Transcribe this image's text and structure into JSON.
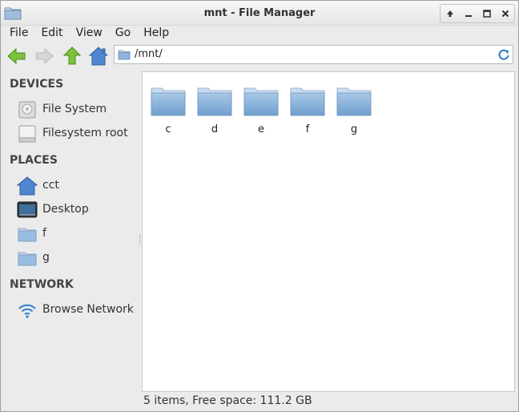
{
  "window": {
    "title": "mnt - File Manager"
  },
  "menu": [
    "File",
    "Edit",
    "View",
    "Go",
    "Help"
  ],
  "location": {
    "path": "/mnt/"
  },
  "sidebar": {
    "devices_title": "DEVICES",
    "devices": [
      {
        "label": "File System",
        "icon": "harddisk-icon"
      },
      {
        "label": "Filesystem root",
        "icon": "drive-icon"
      }
    ],
    "places_title": "PLACES",
    "places": [
      {
        "label": "cct",
        "icon": "home-icon"
      },
      {
        "label": "Desktop",
        "icon": "desktop-icon"
      },
      {
        "label": "f",
        "icon": "folder-icon"
      },
      {
        "label": "g",
        "icon": "folder-icon"
      }
    ],
    "network_title": "NETWORK",
    "network": [
      {
        "label": "Browse Network",
        "icon": "wifi-icon"
      }
    ]
  },
  "files": [
    "c",
    "d",
    "e",
    "f",
    "g"
  ],
  "status": {
    "text": "5 items, Free space: 111.2 GB"
  },
  "colors": {
    "folder_top": "#a9c8e6",
    "folder_bottom": "#6f9fcf",
    "accent_green": "#6bb526",
    "home_blue": "#3f7fcf"
  }
}
